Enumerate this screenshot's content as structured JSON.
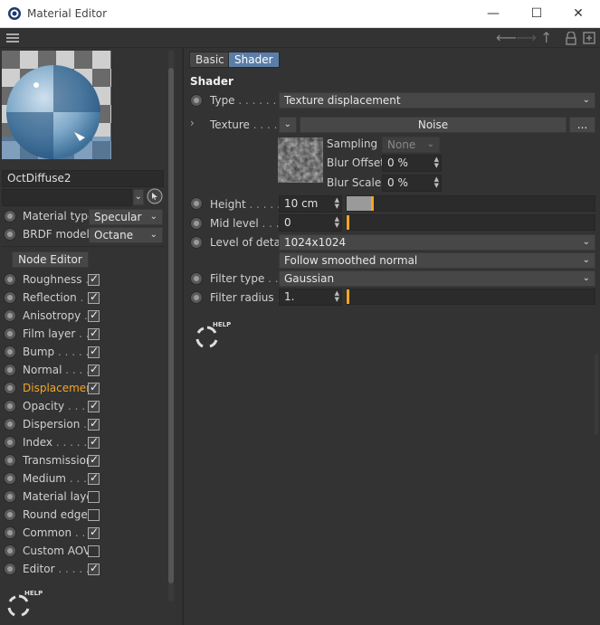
{
  "window": {
    "title": "Material Editor",
    "minimize": "—",
    "maximize": "☐",
    "close": "✕"
  },
  "left": {
    "material_name": "OctDiffuse2",
    "material_type_label": "Material type",
    "material_type_value": "Specular",
    "brdf_label": "BRDF model",
    "brdf_value": "Octane",
    "node_editor": "Node Editor",
    "channels": [
      {
        "label": "Roughness",
        "dots": ". ",
        "checked": true
      },
      {
        "label": "Reflection",
        "dots": ". .",
        "checked": true
      },
      {
        "label": "Anisotropy",
        "dots": " .",
        "checked": true
      },
      {
        "label": "Film layer",
        "dots": " . .",
        "checked": true
      },
      {
        "label": "Bump",
        "dots": " . . . . .",
        "checked": true
      },
      {
        "label": "Normal",
        "dots": ". . . .",
        "checked": true
      },
      {
        "label": "Displacement",
        "dots": "",
        "checked": true,
        "active": true
      },
      {
        "label": "Opacity",
        "dots": ". . . .",
        "checked": true
      },
      {
        "label": "Dispersion",
        "dots": "  .",
        "checked": true
      },
      {
        "label": "Index",
        "dots": " . . . . .",
        "checked": true
      },
      {
        "label": "Transmission",
        "dots": "",
        "checked": true
      },
      {
        "label": "Medium",
        "dots": " . . .",
        "checked": true
      },
      {
        "label": "Material layer",
        "dots": "",
        "checked": false
      },
      {
        "label": "Round edges",
        "dots": "",
        "checked": false
      },
      {
        "label": "Common",
        "dots": "  . .",
        "checked": true
      },
      {
        "label": "Custom AOV",
        "dots": "",
        "checked": false
      },
      {
        "label": "Editor",
        "dots": ". . . . .",
        "checked": true
      }
    ],
    "help_text": "HELP"
  },
  "right": {
    "tabs": [
      "Basic",
      "Shader"
    ],
    "active_tab": "Shader",
    "section_title": "Shader",
    "type_label": "Type",
    "type_dots": ". . . . . . .",
    "type_value": "Texture displacement",
    "texture_label": "Texture",
    "texture_dots": ". . . . .",
    "texture_value": "Noise",
    "texture_more": "...",
    "sampling_label": "Sampling",
    "sampling_value": "None",
    "blur_offset_label": "Blur Offset",
    "blur_offset_value": "0 %",
    "blur_scale_label": "Blur Scale",
    "blur_scale_value": "0 %",
    "height_label": "Height",
    "height_dots": ". . . . .",
    "height_value": "10 cm",
    "height_fraction": 0.1,
    "mid_level_label": "Mid level",
    "mid_level_dots": ". . .",
    "mid_level_value": "0",
    "mid_level_fraction": 0,
    "lod_label": "Level of detail",
    "lod_value": "1024x1024",
    "lod_mode": "Follow smoothed normal",
    "filter_type_label": "Filter type",
    "filter_type_dots": ". . .",
    "filter_type_value": "Gaussian",
    "filter_radius_label": "Filter radius",
    "filter_radius_dots": ". .",
    "filter_radius_value": "1.",
    "filter_radius_fraction": 0,
    "help_text": "HELP"
  },
  "colors": {
    "accent_orange": "#f5a623",
    "active_tab": "#5b7ea8",
    "panel_bg": "#333333"
  }
}
